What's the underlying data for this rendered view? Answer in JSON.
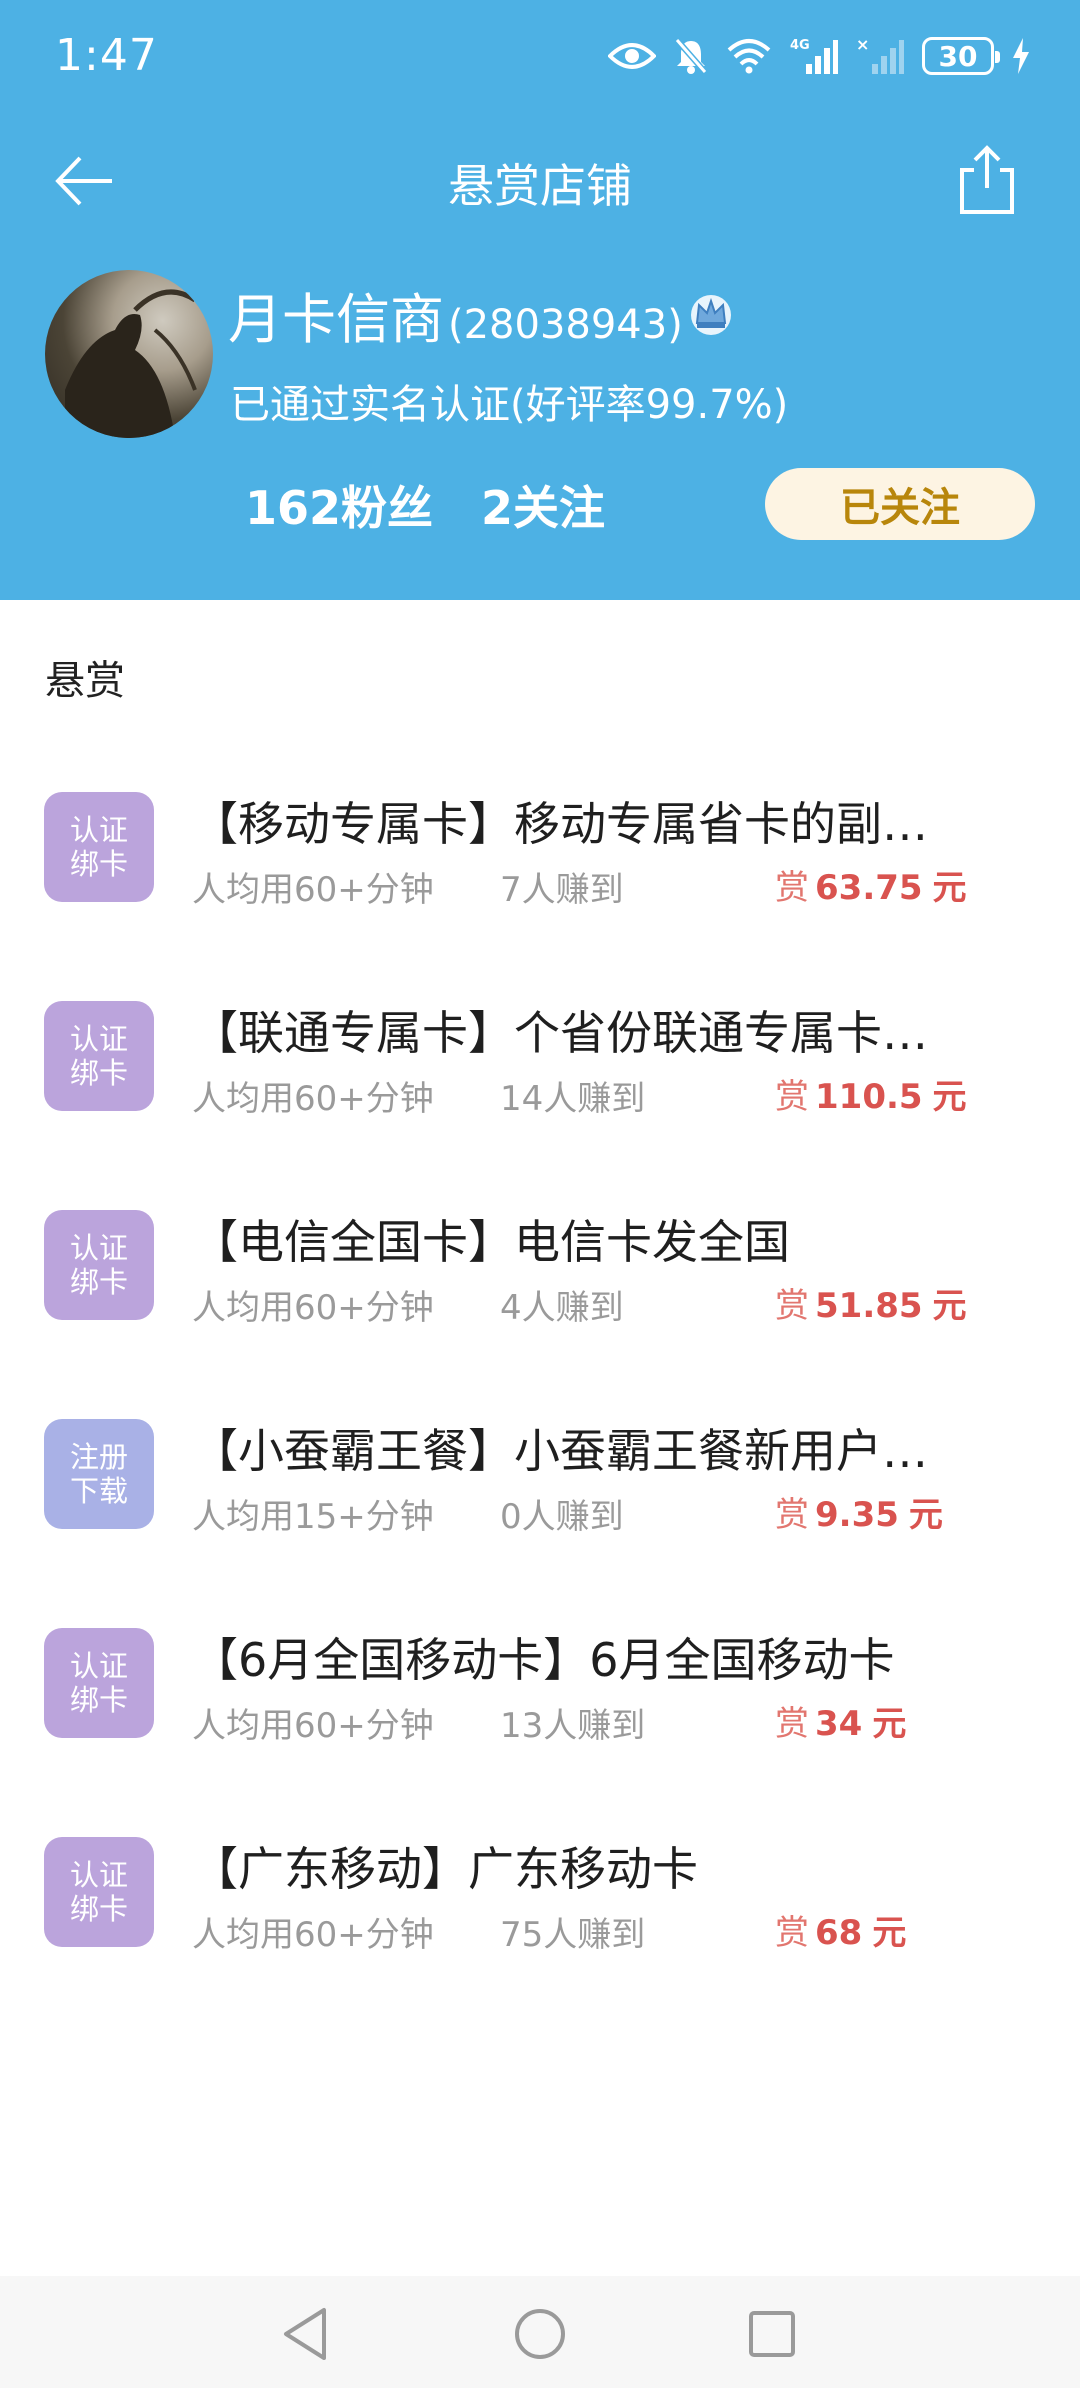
{
  "status_bar": {
    "time": "1:47",
    "network": "4G",
    "battery": "30",
    "icons": [
      "eye-icon",
      "mute-bell-icon",
      "wifi-icon",
      "signal-4g-icon",
      "signal-x-icon",
      "battery-icon",
      "charging-icon"
    ]
  },
  "navbar": {
    "title": "悬赏店铺",
    "back_icon": "back-arrow-icon",
    "share_icon": "share-icon"
  },
  "profile": {
    "name": "月卡信商",
    "uid": "(28038943)",
    "badge_icon": "crown-icon",
    "verify_text": "已通过实名认证(好评率99.7%)",
    "fans": "162粉丝",
    "following": "2关注",
    "follow_button": "已关注"
  },
  "section_title": "悬赏",
  "tasks": [
    {
      "badge_line1": "认证",
      "badge_line2": "绑卡",
      "title": "【移动专属卡】移动专属省卡的副…",
      "time": "人均用60+分钟",
      "earned": "7人赚到",
      "reward_tag": "赏",
      "amount": "63.75",
      "unit": "元"
    },
    {
      "badge_line1": "认证",
      "badge_line2": "绑卡",
      "title": "【联通专属卡】个省份联通专属卡…",
      "time": "人均用60+分钟",
      "earned": "14人赚到",
      "reward_tag": "赏",
      "amount": "110.5",
      "unit": "元"
    },
    {
      "badge_line1": "认证",
      "badge_line2": "绑卡",
      "title": "【电信全国卡】电信卡发全国",
      "time": "人均用60+分钟",
      "earned": "4人赚到",
      "reward_tag": "赏",
      "amount": "51.85",
      "unit": "元"
    },
    {
      "badge_line1": "注册",
      "badge_line2": "下载",
      "title": "【小蚕霸王餐】小蚕霸王餐新用户…",
      "time": "人均用15+分钟",
      "earned": "0人赚到",
      "reward_tag": "赏",
      "amount": "9.35",
      "unit": "元"
    },
    {
      "badge_line1": "认证",
      "badge_line2": "绑卡",
      "title": "【6月全国移动卡】6月全国移动卡",
      "time": "人均用60+分钟",
      "earned": "13人赚到",
      "reward_tag": "赏",
      "amount": "34",
      "unit": "元"
    },
    {
      "badge_line1": "认证",
      "badge_line2": "绑卡",
      "title": "【广东移动】广东移动卡",
      "time": "人均用60+分钟",
      "earned": "75人赚到",
      "reward_tag": "赏",
      "amount": "68",
      "unit": "元"
    }
  ],
  "colors": {
    "header_bg": "#4db1e4",
    "reward": "#d9534f",
    "badge_auth": "#bba4dc",
    "badge_reg": "#a9b1e6",
    "follow_text": "#b8860b"
  }
}
